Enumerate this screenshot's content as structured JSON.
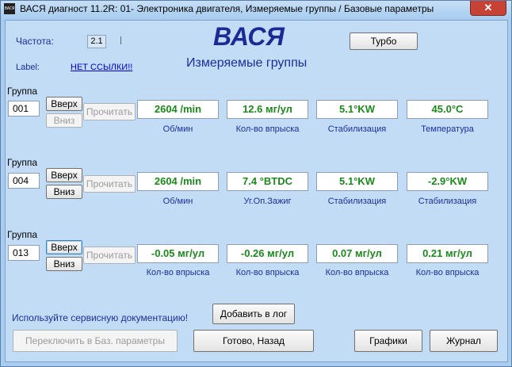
{
  "window": {
    "icon_text": "ВАСЯ",
    "title": "ВАСЯ диагност 11.2R: 01- Электроника двигателя,  Измеряемые группы / Базовые параметры",
    "close_label": "✕"
  },
  "header": {
    "freq_label": "Частота:",
    "freq_value": "2.1",
    "label_label": "Label:",
    "label_link": "НЕТ ССЫЛКИ!!",
    "logo": "ВАСЯ",
    "subtitle": "Измеряемые группы",
    "turbo_button": "Турбо"
  },
  "groups": [
    {
      "group_label": "Группа",
      "number": "001",
      "up": "Вверх",
      "down": "Вниз",
      "read": "Прочитать",
      "values": [
        "2604 /min",
        "12.6 мг/ул",
        "5.1°KW",
        "45.0°C"
      ],
      "captions": [
        "Об/мин",
        "Кол-во впрыска",
        "Стабилизация",
        "Температура"
      ]
    },
    {
      "group_label": "Группа",
      "number": "004",
      "up": "Вверх",
      "down": "Вниз",
      "read": "Прочитать",
      "values": [
        "2604 /min",
        "7.4 °BTDC",
        "5.1°KW",
        "-2.9°KW"
      ],
      "captions": [
        "Об/мин",
        "Уг.Оп.Зажиг",
        "Стабилизация",
        "Стабилизация"
      ]
    },
    {
      "group_label": "Группа",
      "number": "013",
      "up": "Вверх",
      "down": "Вниз",
      "read": "Прочитать",
      "values": [
        "-0.05 мг/ул",
        "-0.26 мг/ул",
        "0.07 мг/ул",
        "0.21 мг/ул"
      ],
      "captions": [
        "Кол-во впрыска",
        "Кол-во впрыска",
        "Кол-во впрыска",
        "Кол-во впрыска"
      ]
    }
  ],
  "footer": {
    "hint": "Используйте сервисную документацию!",
    "add_log": "Добавить в лог",
    "switch_basic": "Переключить в Баз. параметры",
    "done_back": "Готово, Назад",
    "graphs": "Графики",
    "journal": "Журнал"
  },
  "colors": {
    "value_text": "#1a8a1a",
    "caption_text": "#1d2e9c",
    "background": "#c1dcf4"
  }
}
